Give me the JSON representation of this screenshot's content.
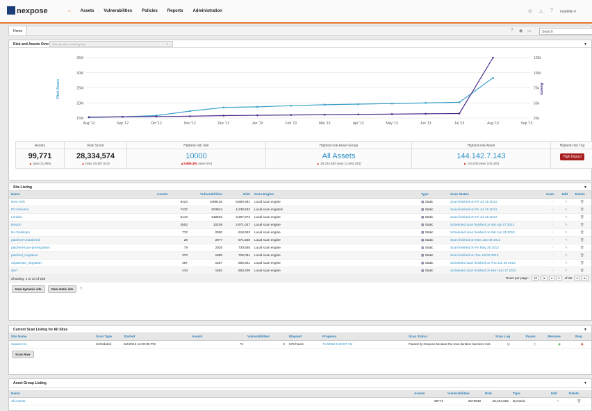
{
  "topbar": {
    "logo": "nexpose",
    "nav": [
      "Assets",
      "Vulnerabilities",
      "Policies",
      "Reports",
      "Administration"
    ],
    "user": "nxadmin ▾"
  },
  "breadcrumb": {
    "home": "Home",
    "search_placeholder": "Search"
  },
  "risk_panel": {
    "title": "Risk and Assets Over Time",
    "filter_placeholder": "View by site or asset group"
  },
  "chart_data": {
    "type": "line",
    "x": [
      "Aug '12",
      "Sep '12",
      "Oct '12",
      "Nov '12",
      "Dec '12",
      "Jan '13",
      "Feb '13",
      "Mar '13",
      "Apr '13",
      "May '13",
      "Jun '13",
      "Jul '13",
      "Aug '13",
      "Sep '13"
    ],
    "ylabel": "Risk Score",
    "y2label": "Assets",
    "yticks": [
      "15M",
      "20M",
      "25M",
      "30M",
      "35M"
    ],
    "y2ticks": [
      "25k",
      "50k",
      "75k",
      "100k",
      "125k"
    ],
    "ylim": [
      15,
      35
    ],
    "y2lim": [
      25,
      125
    ],
    "series": [
      {
        "color": "#3aa0c8",
        "values": [
          15.2,
          15.4,
          15.8,
          17.3,
          18.5,
          18.7,
          19.1,
          19.4,
          19.6,
          19.8,
          20.0,
          20.2,
          28.3
        ]
      },
      {
        "color": "#4a2a8a",
        "values": [
          15.3,
          15.4,
          15.5,
          15.6,
          15.8,
          15.9,
          16.0,
          16.1,
          16.2,
          16.3,
          16.4,
          16.5,
          99.8
        ]
      }
    ]
  },
  "stats": {
    "assets": {
      "label": "Assets",
      "value": "99,771",
      "sub": "(was 31,885)"
    },
    "risk": {
      "label": "Risk Score",
      "value": "28,334,574",
      "sub": "(was 19,367,542)"
    },
    "site": {
      "label": "Highest-risk Site",
      "value": "10000",
      "sub_b": "5,859,391",
      "sub": "(was N/A)"
    },
    "group": {
      "label": "Highest-risk Asset Group",
      "value": "All Assets",
      "sub": "28,334,682 (was 14,964,283)"
    },
    "asset": {
      "label": "Highest-risk Asset",
      "value": "144.142.7.143",
      "sub": "104,535 (was 104,440)"
    },
    "tag": {
      "label": "Highest-risk Tag",
      "value": "High Impact"
    }
  },
  "site_listing": {
    "title": "Site Listing",
    "headers": [
      "Name",
      "Assets",
      "Vulnerabilities",
      "Risk",
      "Scan Engine",
      "Type",
      "Scan Status",
      "Scan",
      "Edit",
      "Delete"
    ],
    "rows": [
      [
        "New York",
        "9424",
        "1089126",
        "5,859,391",
        "Local scan engine",
        "Static",
        "Scan finished on Fri Jul 19 2013"
      ],
      [
        "PCI Servers",
        "7437",
        "823914",
        "4,230,632",
        "Local scan enginelc",
        "Static",
        "Scan finished on Fri Jul 19 2013"
      ],
      [
        "London",
        "5143",
        "618602",
        "3,257,973",
        "Local scan engine",
        "Static",
        "Scan finished on Fri Jul 19 2013"
      ],
      [
        "Boston",
        "2502",
        "10238",
        "2,971,047",
        "Local scan engine",
        "Static",
        "Scheduled scan finished on Sat Apr 27 2013"
      ],
      [
        "NA Desktops",
        "772",
        "2350",
        "618,063",
        "Local scan engine",
        "Static",
        "Scheduled scan finished on Sat Jun 29 2013"
      ],
      [
        "patched+unpatched",
        "28",
        "2077",
        "871,558",
        "Local scan engine",
        "Static",
        "Scan finished on Mon Jan 09 2012"
      ],
      [
        "patched-scan-premigration",
        "79",
        "2025",
        "730,555",
        "Local scan engine",
        "Static",
        "Scan finished on Fri May 25 2012"
      ],
      [
        "patched_migration",
        "370",
        "1895",
        "729,091",
        "Local scan engine",
        "Static",
        "Scan finished on Tue Jul 02 2013"
      ],
      [
        "unpatched_migration",
        "367",
        "1687",
        "566,931",
        "Local scan engine",
        "Static",
        "Scheduled scan finished on Thu Jun 06 2013"
      ],
      [
        "win7",
        "434",
        "1592",
        "650,209",
        "Local scan engine",
        "Static",
        "Scheduled scan finished on Mon Jun 17 2013"
      ]
    ],
    "showing": "Showing: 1 to 10 of 285",
    "rows_per_page": "Rows per page:",
    "rpp": "10",
    "page": "1",
    "of": "of 29",
    "new_dynamic": "New dynamic site",
    "new_static": "New static site"
  },
  "scan_listing": {
    "title": "Current Scan Listing for All Sites",
    "headers": [
      "Site Name",
      "Scan Type",
      "Started",
      "Assets",
      "Vulnerabilities",
      "Elapsed",
      "Progress",
      "Scan Status",
      "Scan Log",
      "Pause",
      "Resume",
      "Stop"
    ],
    "row": [
      "Square Inc",
      "Scheduled",
      "6/2/2013 11:00:05 PM",
      "73",
      "2",
      "678 hours",
      "7/1/2013 5:30:07 AM",
      "Paused by Nexpose because the scan duration has been met."
    ],
    "scan_now": "Scan Now"
  },
  "group_listing": {
    "title": "Asset Group Listing",
    "headers": [
      "Name",
      "Assets",
      "Vulnerabilities",
      "Risk",
      "Type",
      "Edit",
      "Delete"
    ],
    "row": [
      "All Assets",
      "99771",
      "2575938",
      "28,334,682",
      "Dynamic"
    ]
  }
}
